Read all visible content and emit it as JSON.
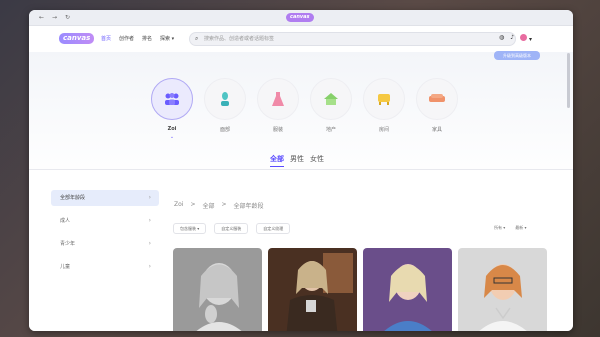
{
  "browser": {
    "tab_title": "canvas",
    "back": "←",
    "forward": "→",
    "refresh": "↻"
  },
  "header": {
    "logo": "canvas",
    "nav": [
      "首页",
      "创作者",
      "排名",
      "探索 ▾"
    ],
    "search_placeholder": "搜索作品、创造者或者话题标签",
    "upgrade_label": "升级到高级版本"
  },
  "categories": [
    {
      "label": "Zoi",
      "icon": "people-icon",
      "glyph": "👥",
      "active": true
    },
    {
      "label": "面部",
      "icon": "bust-icon",
      "glyph": "👤",
      "active": false
    },
    {
      "label": "服装",
      "icon": "dress-icon",
      "glyph": "👗",
      "active": false
    },
    {
      "label": "地产",
      "icon": "house-icon",
      "glyph": "🏡",
      "active": false
    },
    {
      "label": "房间",
      "icon": "sofa-icon",
      "glyph": "🛋",
      "active": false
    },
    {
      "label": "家具",
      "icon": "couch-icon",
      "glyph": "🛋",
      "active": false
    }
  ],
  "gender_tabs": [
    {
      "label": "全部",
      "active": true
    },
    {
      "label": "男性",
      "active": false
    },
    {
      "label": "女性",
      "active": false
    }
  ],
  "sidebar": [
    {
      "label": "全部年龄段",
      "active": true
    },
    {
      "label": "成人",
      "active": false
    },
    {
      "label": "青少年",
      "active": false
    },
    {
      "label": "儿童",
      "active": false
    }
  ],
  "breadcrumb": [
    "Zoi",
    ">",
    "全部",
    ">",
    "全部年龄段"
  ],
  "filters": [
    "包含服装 ▾",
    "自定义服装",
    "自定义纹理"
  ],
  "sorts": [
    "所有 ▾",
    "最新 ▾"
  ],
  "colors": {
    "accent": "#5a4cff",
    "logo_gradient_start": "#9a8bff",
    "logo_gradient_end": "#c08cf5"
  }
}
